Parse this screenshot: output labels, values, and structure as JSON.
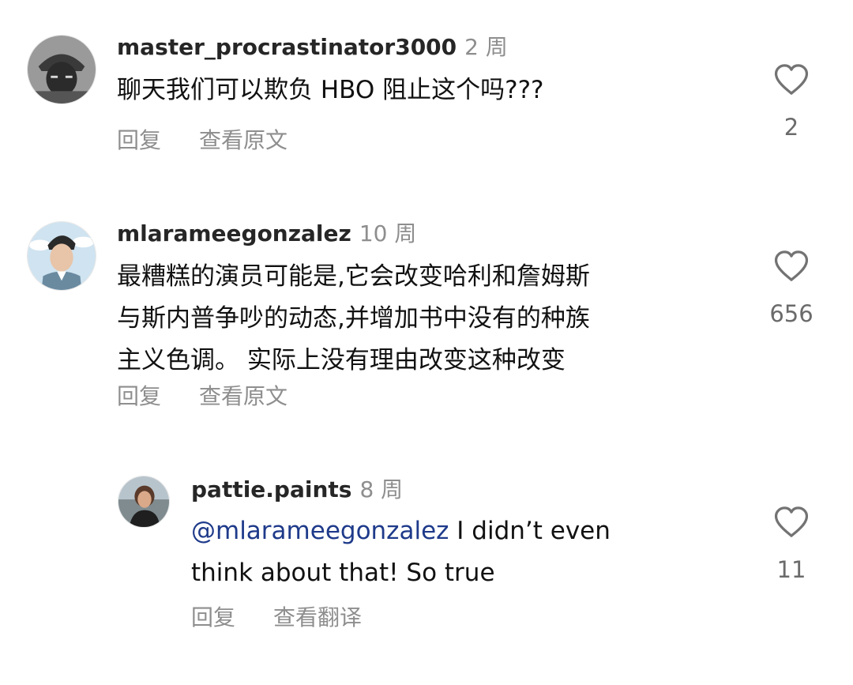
{
  "comments": [
    {
      "username": "master_procrastinator3000",
      "time": "2 周",
      "text": "聊天我们可以欺负 HBO 阻止这个吗???",
      "reply_label": "回复",
      "translate_label": "查看原文",
      "likes": "2"
    },
    {
      "username": "mlarameegonzalez",
      "time": "10 周",
      "text": "最糟糕的演员可能是,它会改变哈利和詹姆斯\n与斯内普争吵的动态,并增加书中没有的种族\n主义色调。 实际上没有理由改变这种改变",
      "reply_label": "回复",
      "translate_label": "查看原文",
      "likes": "656"
    }
  ],
  "reply": {
    "username": "pattie.paints",
    "time": "8 周",
    "mention": "@mlarameegonzalez",
    "text": " I didn’t even\nthink about that! So true",
    "reply_label": "回复",
    "translate_label": "查看翻译",
    "likes": "11"
  },
  "icons": {
    "like": "heart-outline-icon"
  }
}
